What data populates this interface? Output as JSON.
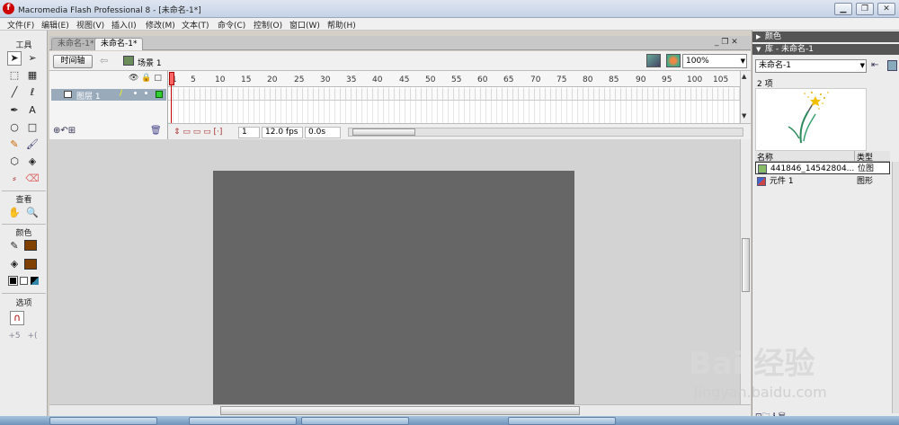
{
  "window": {
    "title": "Macromedia Flash Professional 8 - [未命名-1*]",
    "app_icon_glyph": "f",
    "minimize_glyph": "▁",
    "restore_glyph": "❐",
    "close_glyph": "✕"
  },
  "menu": [
    "文件(F)",
    "编辑(E)",
    "视图(V)",
    "插入(I)",
    "修改(M)",
    "文本(T)",
    "命令(C)",
    "控制(O)",
    "窗口(W)",
    "帮助(H)"
  ],
  "tools": {
    "title": "工具",
    "view_title": "查看",
    "color_title": "颜色",
    "options_title": "选项",
    "icons": [
      "selection-tool-icon",
      "subselection-tool-icon",
      "free-transform-tool-icon",
      "fill-transform-tool-icon",
      "line-tool-icon",
      "lasso-tool-icon",
      "pen-tool-icon",
      "text-tool-icon",
      "oval-tool-icon",
      "rectangle-tool-icon",
      "pencil-tool-icon",
      "brush-tool-icon",
      "ink-bottle-tool-icon",
      "paint-bucket-tool-icon",
      "eyedropper-tool-icon",
      "eraser-tool-icon",
      "hand-tool-icon",
      "zoom-tool-icon"
    ],
    "glyphs": {
      "selection": "➤",
      "subselection": "➢",
      "free_transform": "⬚",
      "fill_transform": "▦",
      "line": "╱",
      "lasso": "ℓ",
      "pen": "✒",
      "text": "A",
      "oval": "○",
      "rect": "□",
      "pencil": "✎",
      "brush": "🖌",
      "ink": "⬡",
      "bucket": "◈",
      "eyedropper": "⸗",
      "eraser": "⌫",
      "hand": "✋",
      "zoom": "🔍",
      "snap": "∩",
      "smooth": "+5",
      "straighten": "+("
    },
    "stroke_color": "#804000",
    "fill_color": "#804000"
  },
  "document": {
    "tabs": [
      {
        "label": "未命名-1*",
        "active": false
      },
      {
        "label": "未命名-1*",
        "active": true
      }
    ],
    "winctl": "_ ❐ ✕",
    "timeline_button": "时间轴",
    "back_glyph": "⇦",
    "scene_label": "场景 1",
    "zoom": "100%"
  },
  "timeline": {
    "header_icons": "👁 🔒 □",
    "layer": {
      "name": "图层 1",
      "pencil": "/",
      "color": "#33cc33"
    },
    "ruler_numbers": [
      "1",
      "5",
      "10",
      "15",
      "20",
      "25",
      "30",
      "35",
      "40",
      "45",
      "50",
      "55",
      "60",
      "65",
      "70",
      "75",
      "80",
      "85",
      "90",
      "95",
      "100",
      "105"
    ],
    "bottom_icons": "⊕↶⊞",
    "delete_icon": "🗑",
    "status": {
      "icons": "⇕ ▭ ▭ ▭ [·]",
      "current_frame": "1",
      "frame_rate": "12.0 fps",
      "elapsed": "0.0s"
    }
  },
  "stage": {
    "background": "#666666"
  },
  "panels": {
    "color_header": "颜色",
    "library_header": "库 - 未命名-1",
    "library_select": "未命名-1",
    "pin_glyph": "⇤",
    "item_count": "2 项",
    "columns": {
      "name": "名称",
      "type": "类型"
    },
    "items": [
      {
        "name": "441846_14542804...",
        "type": "位图",
        "selected": true
      },
      {
        "name": "元件 1",
        "type": "图形",
        "selected": false
      }
    ],
    "bottom_icons": "⊡🗀 ℹ   🗑"
  },
  "watermark": {
    "text": "Bai 经验",
    "url": "jingyan.baidu.com"
  }
}
